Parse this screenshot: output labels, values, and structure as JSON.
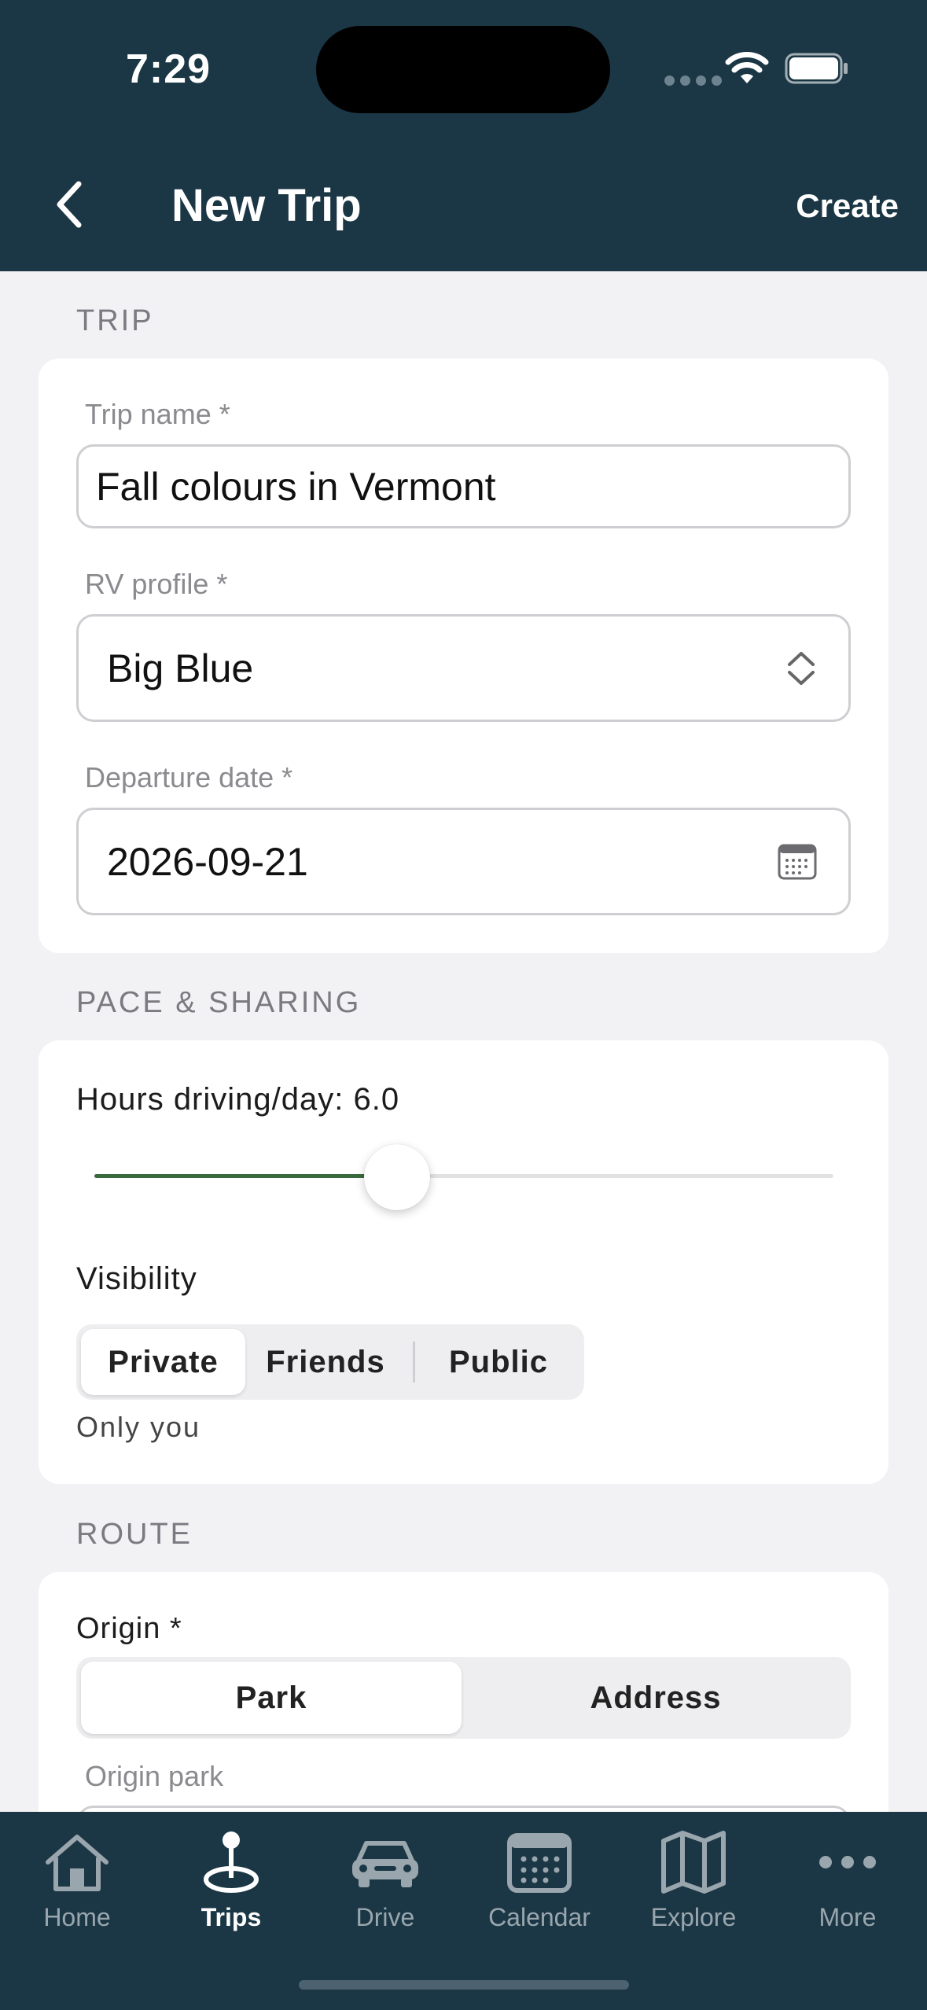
{
  "status_bar": {
    "time": "7:29"
  },
  "header": {
    "title": "New Trip",
    "create_label": "Create"
  },
  "sections": {
    "trip": "TRIP",
    "pace": "PACE & SHARING",
    "route": "ROUTE"
  },
  "trip": {
    "name_label": "Trip name *",
    "name_value": "Fall colours in Vermont",
    "rv_label": "RV profile *",
    "rv_value": "Big Blue",
    "date_label": "Departure date *",
    "date_value": "2026-09-21"
  },
  "pace": {
    "hours_label": "Hours driving/day: 6.0",
    "hours_value": 6.0,
    "slider_fraction": 0.41,
    "visibility_label": "Visibility",
    "visibility_options": [
      "Private",
      "Friends",
      "Public"
    ],
    "visibility_selected": "Private",
    "visibility_hint": "Only you"
  },
  "route": {
    "origin_label": "Origin *",
    "origin_options": [
      "Park",
      "Address"
    ],
    "origin_selected": "Park",
    "origin_park_label": "Origin park"
  },
  "tabbar": {
    "items": [
      {
        "label": "Home",
        "icon": "home-icon"
      },
      {
        "label": "Trips",
        "icon": "trips-pin-icon"
      },
      {
        "label": "Drive",
        "icon": "car-icon"
      },
      {
        "label": "Calendar",
        "icon": "calendar-icon"
      },
      {
        "label": "Explore",
        "icon": "map-icon"
      },
      {
        "label": "More",
        "icon": "more-icon"
      }
    ],
    "active": "Trips"
  },
  "colors": {
    "header_bg": "#1b3745",
    "slider_fill": "#3a6b3e",
    "page_bg": "#f2f2f5"
  }
}
